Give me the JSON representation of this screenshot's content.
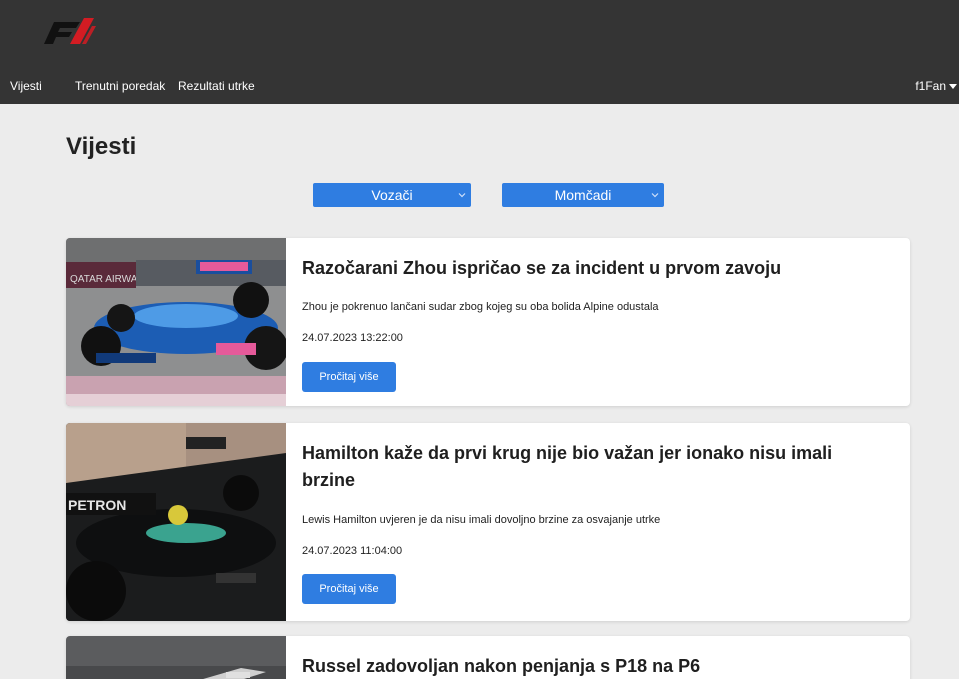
{
  "brand": {
    "logo": "F1 logo"
  },
  "nav": {
    "items": [
      "Vijesti",
      "Trenutni poredak",
      "Rezultati utrke"
    ],
    "user": "f1Fan"
  },
  "page": {
    "title": "Vijesti"
  },
  "filters": {
    "drivers": "Vozači",
    "teams": "Momčadi"
  },
  "articles": [
    {
      "title": "Razočarani Zhou ispričao se za incident u prvom zavoju",
      "description": "Zhou je pokrenuo lančani sudar zbog kojeg su oba bolida Alpine odustala",
      "date": "24.07.2023 13:22:00",
      "button": "Pročitaj više",
      "image": "Alpine F1 car cornering, sponsor banner in background"
    },
    {
      "title": "Hamilton kaže da prvi krug nije bio važan jer ionako nisu imali brzine",
      "description": "Lewis Hamilton uvjeren je da nisu imali dovoljno brzine za osvajanje utrke",
      "date": "24.07.2023 11:04:00",
      "button": "Pročitaj više",
      "image": "Mercedes F1 car number 44 on track"
    },
    {
      "title": "Russel zadovoljan nakon penjanja s P18 na P6",
      "image": "Mercedes F1 car"
    }
  ],
  "colors": {
    "topbar": "#343434",
    "accent": "#2f7de1",
    "background": "#ececec"
  }
}
